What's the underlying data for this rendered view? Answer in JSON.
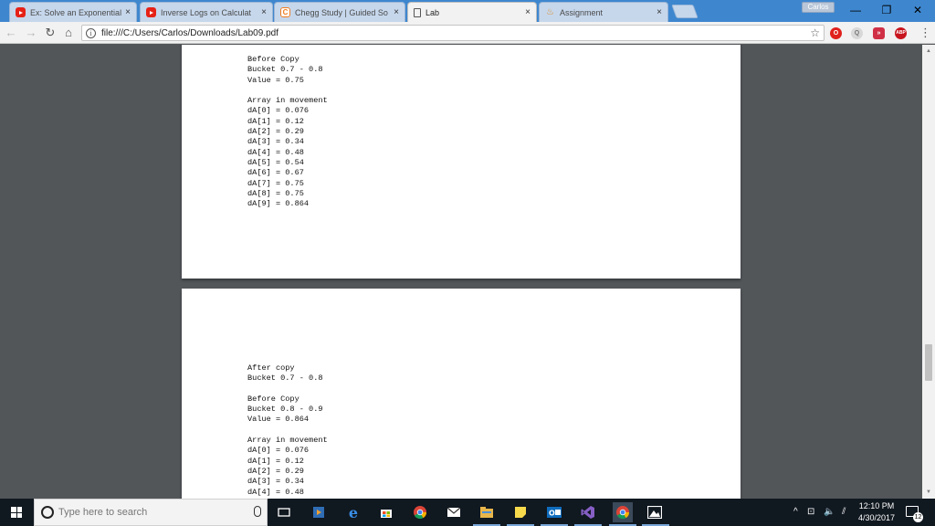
{
  "browser": {
    "tabs": [
      {
        "label": "Ex: Solve an Exponential",
        "icon": "youtube-icon"
      },
      {
        "label": "Inverse Logs on Calculat",
        "icon": "youtube-icon"
      },
      {
        "label": "Chegg Study | Guided So",
        "icon": "chegg-icon"
      },
      {
        "label": "Lab",
        "icon": "document-icon"
      },
      {
        "label": "Assignment",
        "icon": "assignment-icon"
      }
    ],
    "tab_close": "×",
    "profile_name": "Carlos",
    "window_controls": {
      "minimize": "—",
      "maximize": "❐",
      "close": "✕"
    },
    "nav": {
      "back": "←",
      "forward": "→",
      "reload": "↻",
      "home": "⌂"
    },
    "address": {
      "info": "i",
      "url": "file:///C:/Users/Carlos/Downloads/Lab09.pdf",
      "star": "☆"
    },
    "extensions": {
      "opera": "O",
      "search": "Q",
      "pocket": "»",
      "abp": "ABP"
    },
    "menu": "⋮"
  },
  "pdf": {
    "page1_text": "Before Copy\nBucket 0.7 - 0.8\nValue = 0.75\n\nArray in movement\ndA[0] = 0.076\ndA[1] = 0.12\ndA[2] = 0.29\ndA[3] = 0.34\ndA[4] = 0.48\ndA[5] = 0.54\ndA[6] = 0.67\ndA[7] = 0.75\ndA[8] = 0.75\ndA[9] = 0.864",
    "page2_text": "After copy\nBucket 0.7 - 0.8\n\nBefore Copy\nBucket 0.8 - 0.9\nValue = 0.864\n\nArray in movement\ndA[0] = 0.076\ndA[1] = 0.12\ndA[2] = 0.29\ndA[3] = 0.34\ndA[4] = 0.48",
    "scroll_up": "▲",
    "scroll_down": "▼"
  },
  "taskbar": {
    "search_placeholder": "Type here to search",
    "tray": {
      "chevron": "^",
      "network": "⊡",
      "volume": "🔈",
      "wifi": "⫽"
    },
    "time": "12:10 PM",
    "date": "4/30/2017",
    "notifications": "12"
  },
  "colors": {
    "tabstrip": "#3e87cf",
    "viewer_bg": "#525659",
    "taskbar": "#101820"
  }
}
